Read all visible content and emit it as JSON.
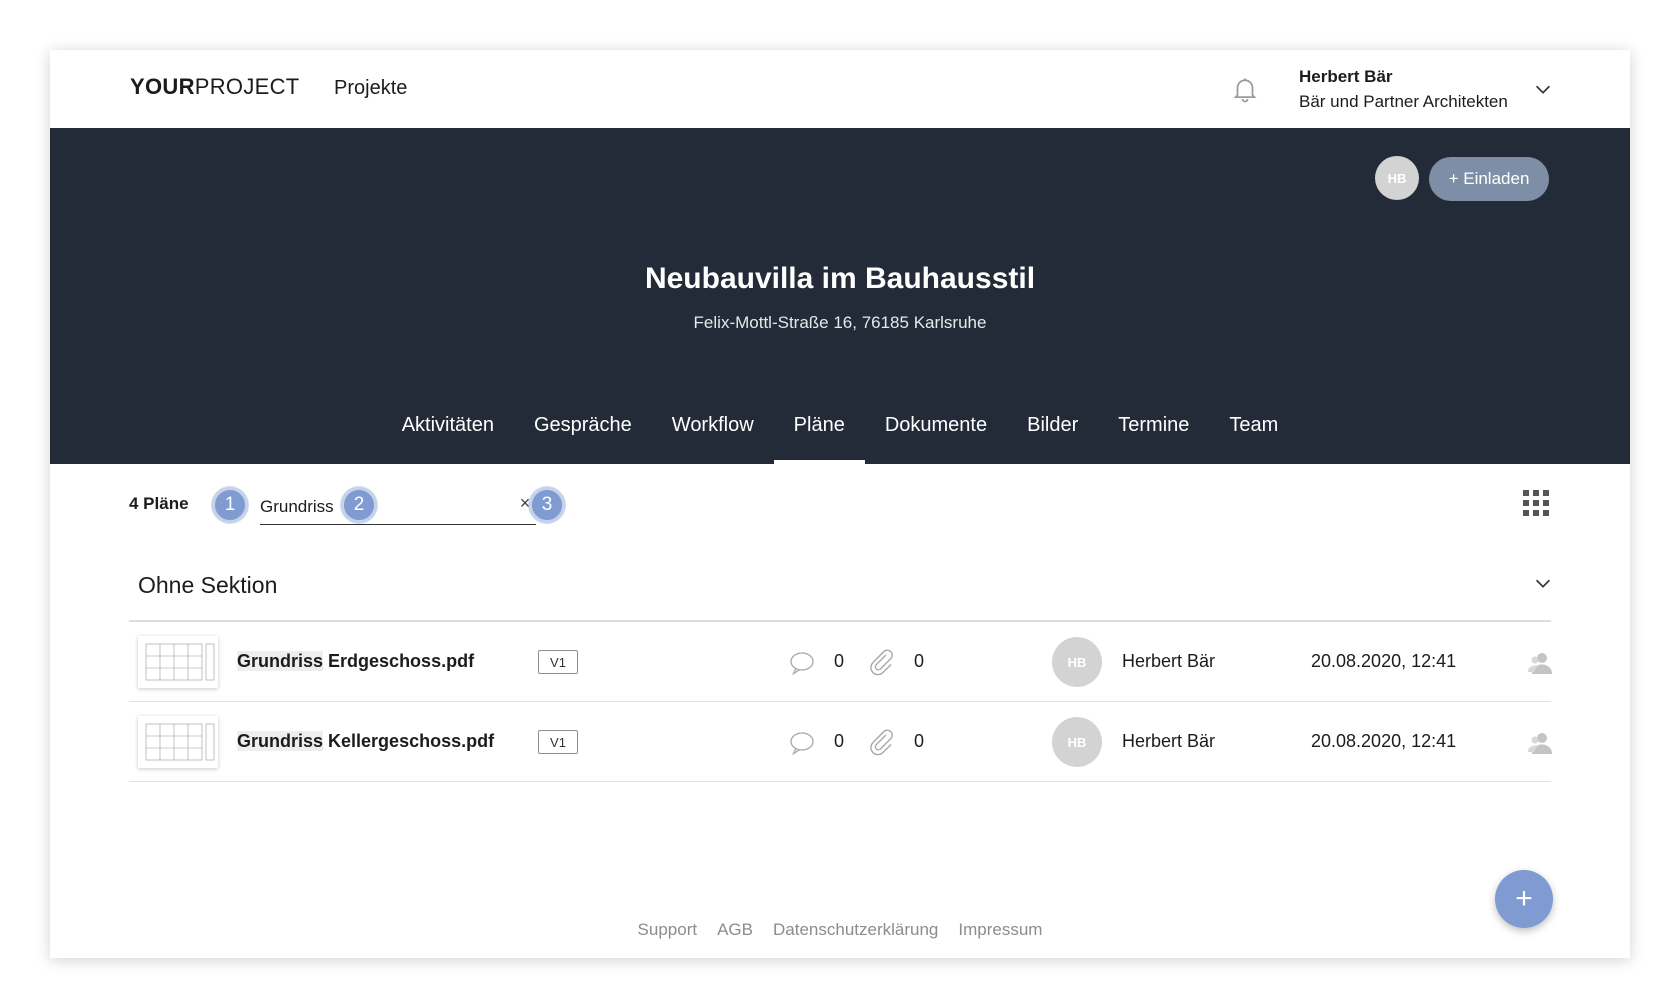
{
  "app": {
    "logo_bold": "YOUR",
    "logo_light": "PROJECT",
    "nav_projects": "Projekte"
  },
  "user": {
    "name": "Herbert Bär",
    "organization": "Bär und Partner Architekten"
  },
  "hero": {
    "avatar_initials": "HB",
    "invite_label": "+ Einladen",
    "title": "Neubauvilla im Bauhausstil",
    "address": "Felix-Mottl-Straße 16, 76185 Karlsruhe"
  },
  "tabs": [
    {
      "label": "Aktivitäten",
      "active": false
    },
    {
      "label": "Gespräche",
      "active": false
    },
    {
      "label": "Workflow",
      "active": false
    },
    {
      "label": "Pläne",
      "active": true
    },
    {
      "label": "Dokumente",
      "active": false
    },
    {
      "label": "Bilder",
      "active": false
    },
    {
      "label": "Termine",
      "active": false
    },
    {
      "label": "Team",
      "active": false
    }
  ],
  "filter": {
    "count_label": "4 Pläne",
    "search_value": "Grundriss",
    "steps": [
      "1",
      "2",
      "3"
    ],
    "clear_symbol": "×"
  },
  "section": {
    "title": "Ohne Sektion"
  },
  "plans": [
    {
      "name_highlight": "Grundriss",
      "name_rest": " Erdgeschoss.pdf",
      "version": "V1",
      "comments": "0",
      "attachments": "0",
      "author_initials": "HB",
      "author": "Herbert Bär",
      "date": "20.08.2020, 12:41"
    },
    {
      "name_highlight": "Grundriss",
      "name_rest": " Kellergeschoss.pdf",
      "version": "V1",
      "comments": "0",
      "attachments": "0",
      "author_initials": "HB",
      "author": "Herbert Bär",
      "date": "20.08.2020, 12:41"
    }
  ],
  "footer": {
    "links": [
      "Support",
      "AGB",
      "Datenschutzerklärung",
      "Impressum"
    ]
  },
  "fab_label": "+",
  "colors": {
    "hero_bg": "#232b38",
    "accent": "#7f9bd1",
    "invite_bg": "#7f8ea7",
    "avatar_bg": "#d3d3d3"
  },
  "icons": [
    "bell-icon",
    "chevron-down-icon",
    "grid-view-icon",
    "comment-icon",
    "paperclip-icon",
    "share-user-icon",
    "close-icon"
  ]
}
